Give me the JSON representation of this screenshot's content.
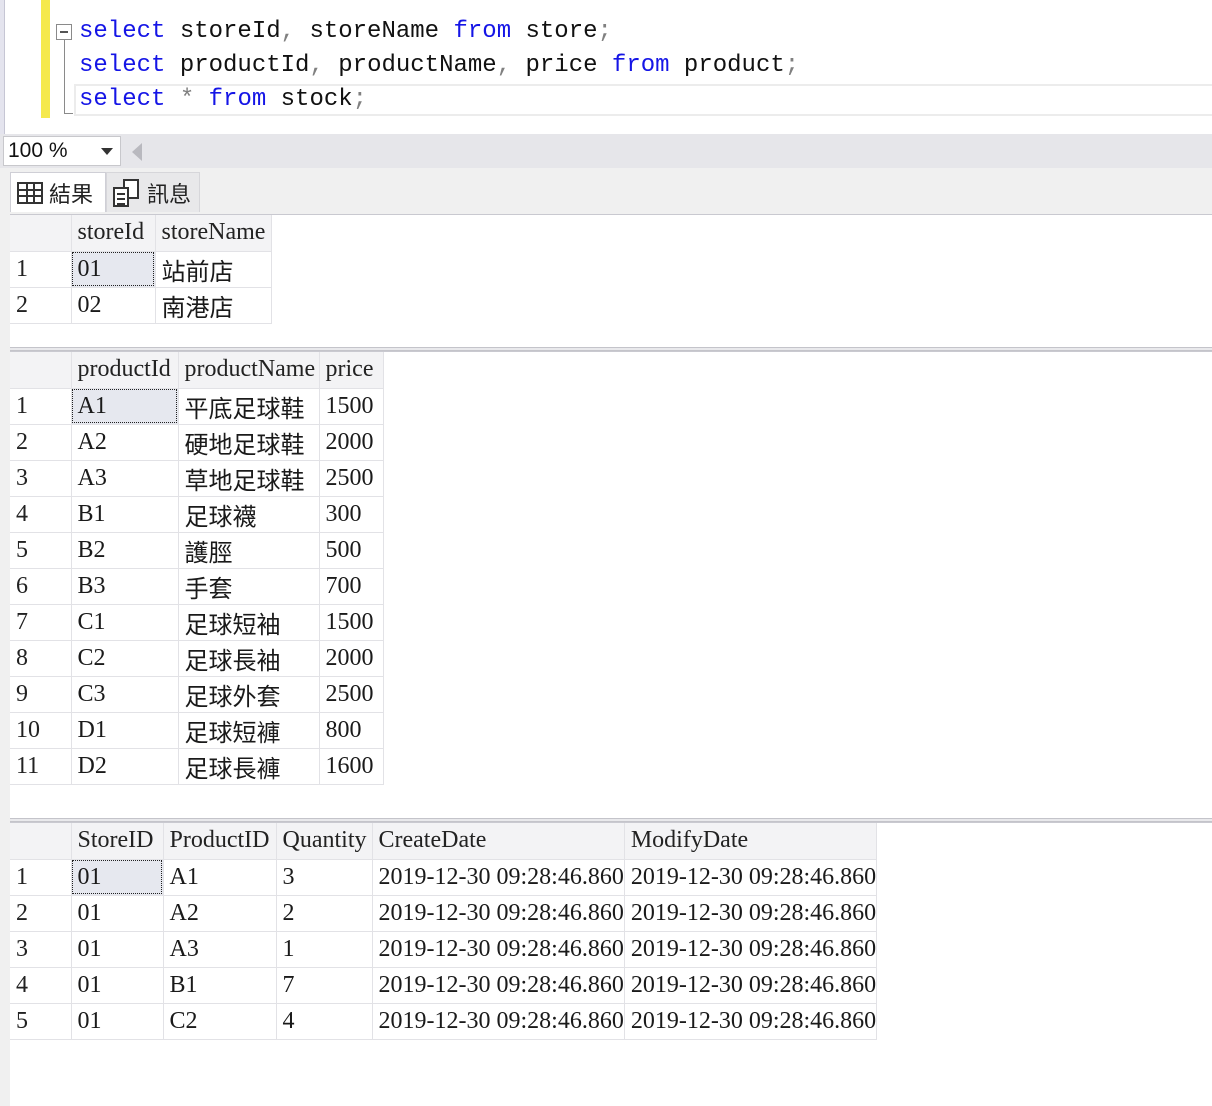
{
  "editor": {
    "lines": [
      [
        {
          "t": "select",
          "k": "kw"
        },
        {
          "t": " storeId",
          "k": ""
        },
        {
          "t": ",",
          "k": "op"
        },
        {
          "t": " storeName ",
          "k": ""
        },
        {
          "t": "from",
          "k": "kw"
        },
        {
          "t": " store",
          "k": ""
        },
        {
          "t": ";",
          "k": "op"
        }
      ],
      [
        {
          "t": "select",
          "k": "kw"
        },
        {
          "t": " productId",
          "k": ""
        },
        {
          "t": ",",
          "k": "op"
        },
        {
          "t": " productName",
          "k": ""
        },
        {
          "t": ",",
          "k": "op"
        },
        {
          "t": " price ",
          "k": ""
        },
        {
          "t": "from",
          "k": "kw"
        },
        {
          "t": " product",
          "k": ""
        },
        {
          "t": ";",
          "k": "op"
        }
      ],
      [
        {
          "t": "select",
          "k": "kw"
        },
        {
          "t": " ",
          "k": ""
        },
        {
          "t": "*",
          "k": "op"
        },
        {
          "t": " ",
          "k": ""
        },
        {
          "t": "from",
          "k": "kw"
        },
        {
          "t": " stock",
          "k": ""
        },
        {
          "t": ";",
          "k": "op"
        }
      ]
    ]
  },
  "zoom": {
    "value": "100 %"
  },
  "tabs": {
    "results_label": "結果",
    "messages_label": "訊息"
  },
  "grids": [
    {
      "name": "store",
      "columns": [
        "storeId",
        "storeName"
      ],
      "rows": [
        [
          "01",
          "站前店"
        ],
        [
          "02",
          "南港店"
        ]
      ]
    },
    {
      "name": "product",
      "columns": [
        "productId",
        "productName",
        "price"
      ],
      "rows": [
        [
          "A1",
          "平底足球鞋",
          "1500"
        ],
        [
          "A2",
          "硬地足球鞋",
          "2000"
        ],
        [
          "A3",
          "草地足球鞋",
          "2500"
        ],
        [
          "B1",
          "足球襪",
          "300"
        ],
        [
          "B2",
          "護脛",
          "500"
        ],
        [
          "B3",
          "手套",
          "700"
        ],
        [
          "C1",
          "足球短袖",
          "1500"
        ],
        [
          "C2",
          "足球長袖",
          "2000"
        ],
        [
          "C3",
          "足球外套",
          "2500"
        ],
        [
          "D1",
          "足球短褲",
          "800"
        ],
        [
          "D2",
          "足球長褲",
          "1600"
        ]
      ]
    },
    {
      "name": "stock",
      "columns": [
        "StoreID",
        "ProductID",
        "Quantity",
        "CreateDate",
        "ModifyDate"
      ],
      "rows": [
        [
          "01",
          "A1",
          "3",
          "2019-12-30 09:28:46.860",
          "2019-12-30 09:28:46.860"
        ],
        [
          "01",
          "A2",
          "2",
          "2019-12-30 09:28:46.860",
          "2019-12-30 09:28:46.860"
        ],
        [
          "01",
          "A3",
          "1",
          "2019-12-30 09:28:46.860",
          "2019-12-30 09:28:46.860"
        ],
        [
          "01",
          "B1",
          "7",
          "2019-12-30 09:28:46.860",
          "2019-12-30 09:28:46.860"
        ],
        [
          "01",
          "C2",
          "4",
          "2019-12-30 09:28:46.860",
          "2019-12-30 09:28:46.860"
        ]
      ]
    }
  ]
}
